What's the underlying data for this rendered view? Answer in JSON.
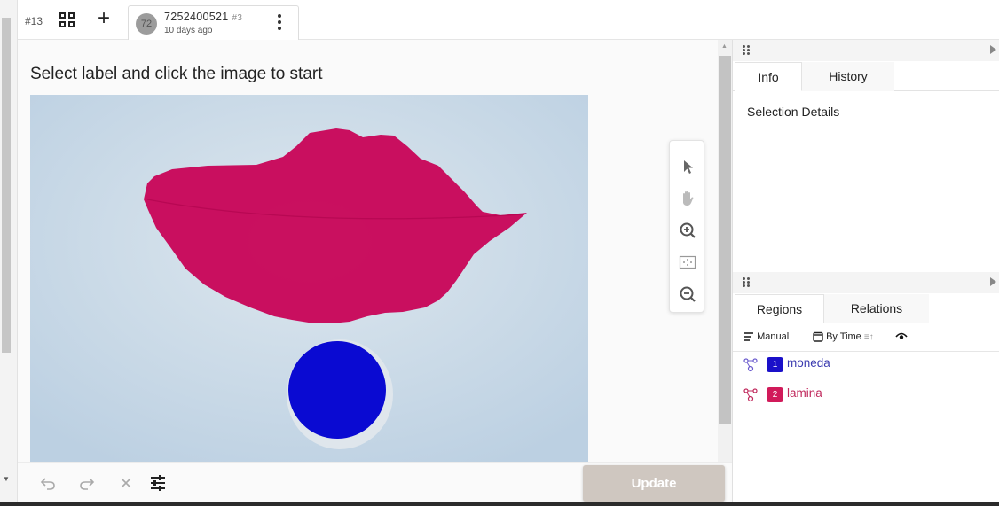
{
  "topbar": {
    "task_id": "#13",
    "annotation": {
      "avatar_initials": "72",
      "id": "7252400521",
      "number": "#3",
      "time": "10 days ago"
    }
  },
  "main": {
    "instruction": "Select label and click the image to start",
    "tools": [
      "pointer-icon",
      "hand-pan-icon",
      "zoom-in-icon",
      "fit-to-screen-icon",
      "zoom-out-icon"
    ]
  },
  "bottom": {
    "update_label": "Update"
  },
  "right_panel": {
    "tabs": [
      {
        "label": "Info",
        "active": true
      },
      {
        "label": "History",
        "active": false
      }
    ],
    "selection_details": "Selection Details",
    "region_tabs": [
      {
        "label": "Regions",
        "active": true
      },
      {
        "label": "Relations",
        "active": false
      }
    ],
    "toolbar": {
      "manual": "Manual",
      "by_time": "By Time"
    },
    "regions": [
      {
        "index": "1",
        "label": "moneda",
        "color": "#1a10c9",
        "text_color": "#3b3bb0"
      },
      {
        "index": "2",
        "label": "lamina",
        "color": "#d11a5a",
        "text_color": "#c0285c"
      }
    ]
  },
  "colors": {
    "leaf_mask": "#c8085a",
    "coin_mask": "#0a0ad2",
    "update_button": "#cfc7c0"
  }
}
